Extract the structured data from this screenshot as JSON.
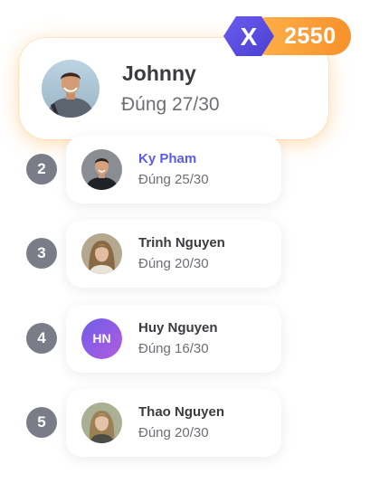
{
  "current_user": {
    "name": "Johnny",
    "score": "Đúng 27/30"
  },
  "points": {
    "value": "2550",
    "logo_icon": "x-hexagon-logo",
    "logo_letter": "X"
  },
  "leaderboard": [
    {
      "rank": "2",
      "name": "Ky Pham",
      "score": "Đúng 25/30",
      "highlight": true,
      "avatar": "photo"
    },
    {
      "rank": "3",
      "name": "Trinh Nguyen",
      "score": "Đúng 20/30",
      "highlight": false,
      "avatar": "photo"
    },
    {
      "rank": "4",
      "name": "Huy Nguyen",
      "score": "Đúng 16/30",
      "highlight": false,
      "avatar": "initials",
      "initials": "HN"
    },
    {
      "rank": "5",
      "name": "Thao Nguyen",
      "score": "Đúng 20/30",
      "highlight": false,
      "avatar": "photo"
    }
  ],
  "colors": {
    "accent_orange": "#f7912b",
    "logo_purple": "#5b4fe0",
    "highlight_name": "#5b5de6",
    "rank_badge": "#7a7d88"
  }
}
